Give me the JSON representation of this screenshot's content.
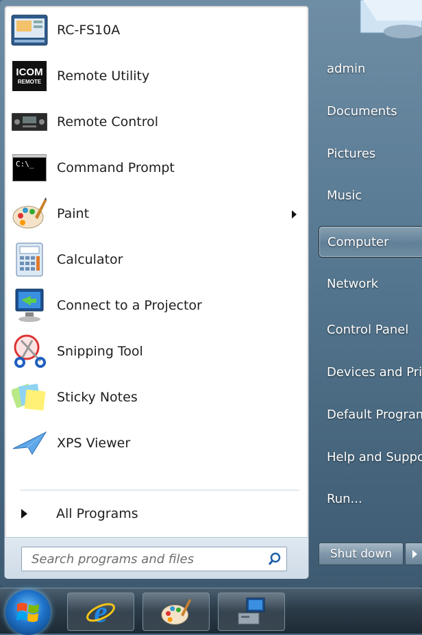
{
  "start_menu": {
    "programs": [
      {
        "label": "RC-FS10A",
        "icon": "rc-fs10a-app-icon"
      },
      {
        "label": "Remote Utility",
        "icon": "icom-remote-icon"
      },
      {
        "label": "Remote Control",
        "icon": "remote-control-radio-icon"
      },
      {
        "label": "Command Prompt",
        "icon": "command-prompt-icon"
      },
      {
        "label": "Paint",
        "icon": "paint-palette-icon",
        "has_submenu": true
      },
      {
        "label": "Calculator",
        "icon": "calculator-icon"
      },
      {
        "label": "Connect to a Projector",
        "icon": "projector-monitor-icon"
      },
      {
        "label": "Snipping Tool",
        "icon": "scissors-icon"
      },
      {
        "label": "Sticky Notes",
        "icon": "sticky-notes-icon"
      },
      {
        "label": "XPS Viewer",
        "icon": "paper-plane-icon"
      }
    ],
    "all_programs_label": "All Programs",
    "search": {
      "placeholder": "Search programs and files"
    },
    "icom_text": {
      "top": "ICOM",
      "bottom": "REMOTE"
    },
    "cmd_text": "C:\\_",
    "right_items": [
      {
        "label": "admin"
      },
      {
        "label": "Documents"
      },
      {
        "label": "Pictures"
      },
      {
        "label": "Music"
      },
      {
        "label": "Computer",
        "selected": true
      },
      {
        "label": "Network"
      },
      {
        "label": "Control Panel"
      },
      {
        "label": "Devices and Printers"
      },
      {
        "label": "Default Programs"
      },
      {
        "label": "Help and Support"
      },
      {
        "label": "Run..."
      }
    ],
    "shutdown_label": "Shut down"
  },
  "taskbar": {
    "items": [
      "internet-explorer-icon",
      "paint-palette-icon",
      "computer-network-icon"
    ]
  },
  "colors": {
    "accent": "#1f73c9",
    "menu_bg": "#557790",
    "text_dark": "#1e1e1e"
  }
}
